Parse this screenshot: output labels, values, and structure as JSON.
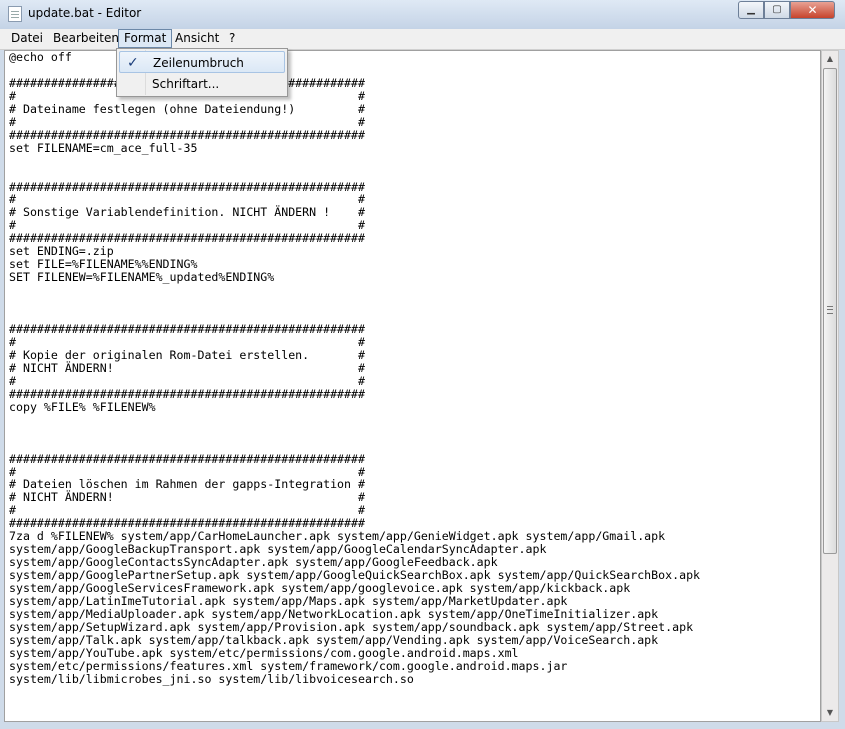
{
  "window": {
    "title": "update.bat - Editor"
  },
  "menubar": {
    "items": [
      {
        "label": "Datei"
      },
      {
        "label": "Bearbeiten"
      },
      {
        "label": "Format"
      },
      {
        "label": "Ansicht"
      },
      {
        "label": "?"
      }
    ]
  },
  "format_menu": {
    "items": [
      {
        "label": "Zeilenumbruch",
        "checked": true
      },
      {
        "label": "Schriftart..."
      }
    ]
  },
  "editor": {
    "text": "@echo off\n\n###################################################\n#                                                 #\n# Dateiname festlegen (ohne Dateiendung!)         #\n#                                                 #\n###################################################\nset FILENAME=cm_ace_full-35\n\n\n###################################################\n#                                                 #\n# Sonstige Variablendefinition. NICHT ÄNDERN !    #\n#                                                 #\n###################################################\nset ENDING=.zip\nset FILE=%FILENAME%%ENDING%\nSET FILENEW=%FILENAME%_updated%ENDING%\n\n\n\n###################################################\n#                                                 #\n# Kopie der originalen Rom-Datei erstellen.       #\n# NICHT ÄNDERN!                                   #\n#                                                 #\n###################################################\ncopy %FILE% %FILENEW%\n\n\n\n###################################################\n#                                                 #\n# Dateien löschen im Rahmen der gapps-Integration #\n# NICHT ÄNDERN!                                   #\n#                                                 #\n###################################################\n7za d %FILENEW% system/app/CarHomeLauncher.apk system/app/GenieWidget.apk system/app/Gmail.apk\nsystem/app/GoogleBackupTransport.apk system/app/GoogleCalendarSyncAdapter.apk\nsystem/app/GoogleContactsSyncAdapter.apk system/app/GoogleFeedback.apk\nsystem/app/GooglePartnerSetup.apk system/app/GoogleQuickSearchBox.apk system/app/QuickSearchBox.apk\nsystem/app/GoogleServicesFramework.apk system/app/googlevoice.apk system/app/kickback.apk\nsystem/app/LatinImeTutorial.apk system/app/Maps.apk system/app/MarketUpdater.apk\nsystem/app/MediaUploader.apk system/app/NetworkLocation.apk system/app/OneTimeInitializer.apk\nsystem/app/SetupWizard.apk system/app/Provision.apk system/app/soundback.apk system/app/Street.apk\nsystem/app/Talk.apk system/app/talkback.apk system/app/Vending.apk system/app/VoiceSearch.apk\nsystem/app/YouTube.apk system/etc/permissions/com.google.android.maps.xml\nsystem/etc/permissions/features.xml system/framework/com.google.android.maps.jar\nsystem/lib/libmicrobes_jni.so system/lib/libvoicesearch.so"
  },
  "icons": {
    "app": "notepad-icon",
    "minimize": "minimize-icon",
    "maximize": "maximize-icon",
    "close": "close-icon",
    "scroll_up": "arrow-up-icon",
    "scroll_down": "arrow-down-icon",
    "check": "checkmark-icon"
  }
}
